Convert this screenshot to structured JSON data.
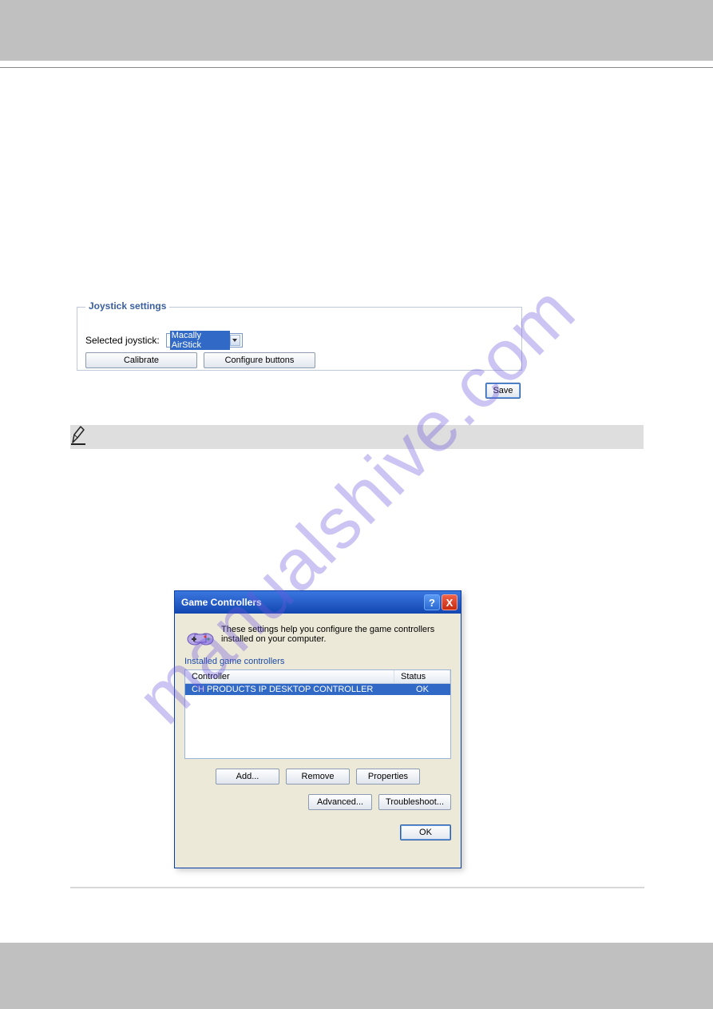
{
  "watermark": "manualshive.com",
  "joystick_panel": {
    "legend": "Joystick settings",
    "label": "Selected joystick:",
    "selected_value": "Macally AirStick",
    "calibrate_btn": "Calibrate",
    "configure_btn": "Configure buttons",
    "save_btn": "Save"
  },
  "game_controllers_dialog": {
    "title": "Game Controllers",
    "description": "These settings help you configure the game controllers installed on your computer.",
    "section_label": "Installed game controllers",
    "columns": {
      "controller": "Controller",
      "status": "Status"
    },
    "rows": [
      {
        "controller": "CH PRODUCTS IP DESKTOP CONTROLLER",
        "status": "OK"
      }
    ],
    "buttons": {
      "add": "Add...",
      "remove": "Remove",
      "properties": "Properties",
      "advanced": "Advanced...",
      "troubleshoot": "Troubleshoot...",
      "ok": "OK"
    },
    "titlebar": {
      "help": "?",
      "close": "X"
    }
  }
}
